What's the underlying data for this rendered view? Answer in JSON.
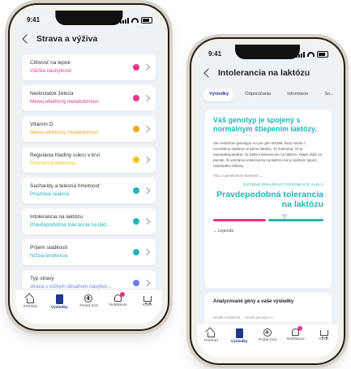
{
  "status_time": "9:41",
  "left": {
    "title": "Strava a výživa",
    "items": [
      {
        "title": "Citlivosť na lepok",
        "status": "Väčšia náchylnosť",
        "color": "#e8358a"
      },
      {
        "title": "Nedostatok železa",
        "status": "Menej efektívny metabolizmus",
        "color": "#e8358a"
      },
      {
        "title": "Vitamín D",
        "status": "Menej efektívny metabolizmus",
        "color": "#f5a623"
      },
      {
        "title": "Regulácia hladiny cukru v krvi",
        "status": "Priemerná efektivita",
        "color": "#f5c518"
      },
      {
        "title": "Sacharidy a telesná hmotnosť",
        "status": "Priaznivá reakcia",
        "color": "#21b5b8"
      },
      {
        "title": "Intolerancia na laktózu",
        "status": "Pravdepodobná tolerancia na lakt...",
        "color": "#21b5b8"
      },
      {
        "title": "Príjem sladkostí",
        "status": "Nižšia tendencia",
        "color": "#21b5b8"
      },
      {
        "title": "Typ stravy",
        "status": "strava s nízkym obsahom nasýten...",
        "color": "#6b7fe8"
      }
    ]
  },
  "tabs": [
    {
      "label": "Prehľad",
      "icon": "home-icon"
    },
    {
      "label": "Výsledky",
      "icon": "results-icon"
    },
    {
      "label": "Pridať kód",
      "icon": "plus-circle-icon"
    },
    {
      "label": "Notifikácie",
      "icon": "bell-icon"
    },
    {
      "label": "Košík",
      "icon": "cart-icon"
    }
  ],
  "right": {
    "title": "Intolerancia na laktózu",
    "subtabs": [
      "Výsledky",
      "Odporúčania",
      "Informácie",
      "So..."
    ],
    "headline": "Váš genotyp je spojený s normálnym štiepením laktózy.",
    "body": "Ste nositeľom genotypu AA pre gén MCM6, ktorý súvisí s normálnou hladinou enzýmu laktázy. To znamená, že je nepravdepodobné, že trpíte intoleranciou na laktózu. Majte však na pamäti, že primárna intolerancia na laktózu nie je jediným typom nedostatku laktázy.",
    "more_link": "Viac o genetickom kontexte",
    "effect_label": "ZISTENÉ PRIAZNIVO PÔSOBIACE ALELY",
    "result": "Pravdepodobná tolerancia na laktózu",
    "legend_label": "Legenda",
    "genes_title": "Analyzované gény a vaše výsledky",
    "genes_small": "MCM6 rs4988235 ... MCM6 genotyp AA",
    "scale_colors": [
      "#e8358a",
      "#21b5b8"
    ]
  }
}
